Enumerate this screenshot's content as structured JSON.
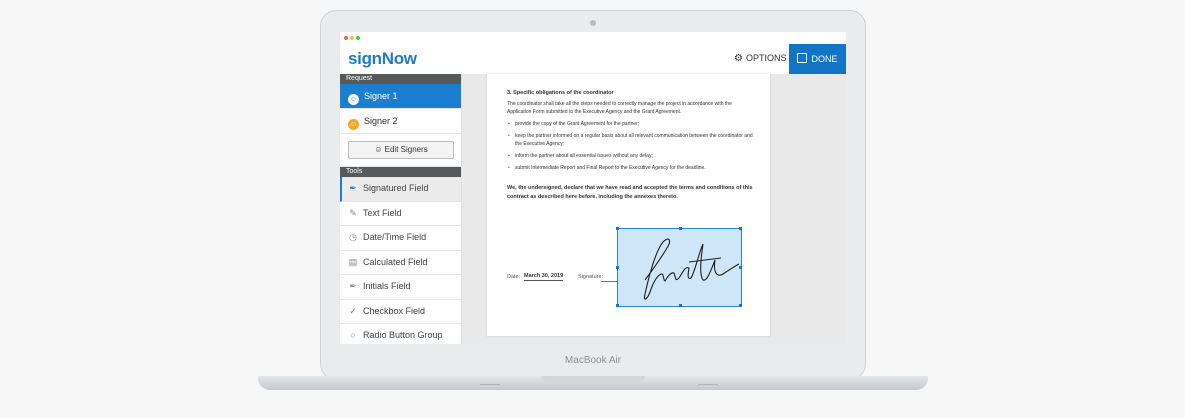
{
  "device": {
    "model_label": "MacBook Air"
  },
  "app": {
    "logo": "signNow",
    "window_dots": [
      "#f25f58",
      "#fbbe2e",
      "#3ac948"
    ],
    "header": {
      "options_label": "OPTIONS",
      "done_label": "DONE"
    }
  },
  "sidebar": {
    "request_label": "Request",
    "signers": [
      {
        "label": "Signer 1",
        "color": "#1a7fd1",
        "active": true
      },
      {
        "label": "Signer 2",
        "color": "#f5a623",
        "active": false
      }
    ],
    "edit_signers_label": "Edit Signers",
    "tools_label": "Tools",
    "tools": [
      {
        "label": "Signatured Field",
        "icon": "pen-nib-icon",
        "active": true
      },
      {
        "label": "Text Field",
        "icon": "pencil-icon"
      },
      {
        "label": "Date/Time Field",
        "icon": "clock-icon"
      },
      {
        "label": "Calculated Field",
        "icon": "calculator-icon"
      },
      {
        "label": "Initials Field",
        "icon": "initials-pen-icon"
      },
      {
        "label": "Checkbox Field",
        "icon": "checkmark-icon"
      },
      {
        "label": "Radio Button Group",
        "icon": "radio-icon"
      }
    ]
  },
  "document": {
    "section_title": "3. Specific obligations of the coordinator",
    "intro": "The coordinator shall take all the steps needed to correctly manage the project in accordance with the Application Form submitted to the Executive Agency and the Grant Agreement.",
    "bullets": [
      "provide the copy of the Grant Agreement for the partner;",
      "keep the partner informed on a regular basis about all relevant communication between the coordinator and the Executive Agency;",
      "inform the partner about all essential issues without any delay;",
      "submit Intermediate Report and Final Report to the Executive Agency for the deadline."
    ],
    "declaration": "We, the undersigned, declare that we have read and accepted the terms and conditions of this contract as described here before, including the annexes thereto.",
    "date_label": "Date:",
    "date_value": "March 30, 2019",
    "signature_label": "Signature:"
  }
}
